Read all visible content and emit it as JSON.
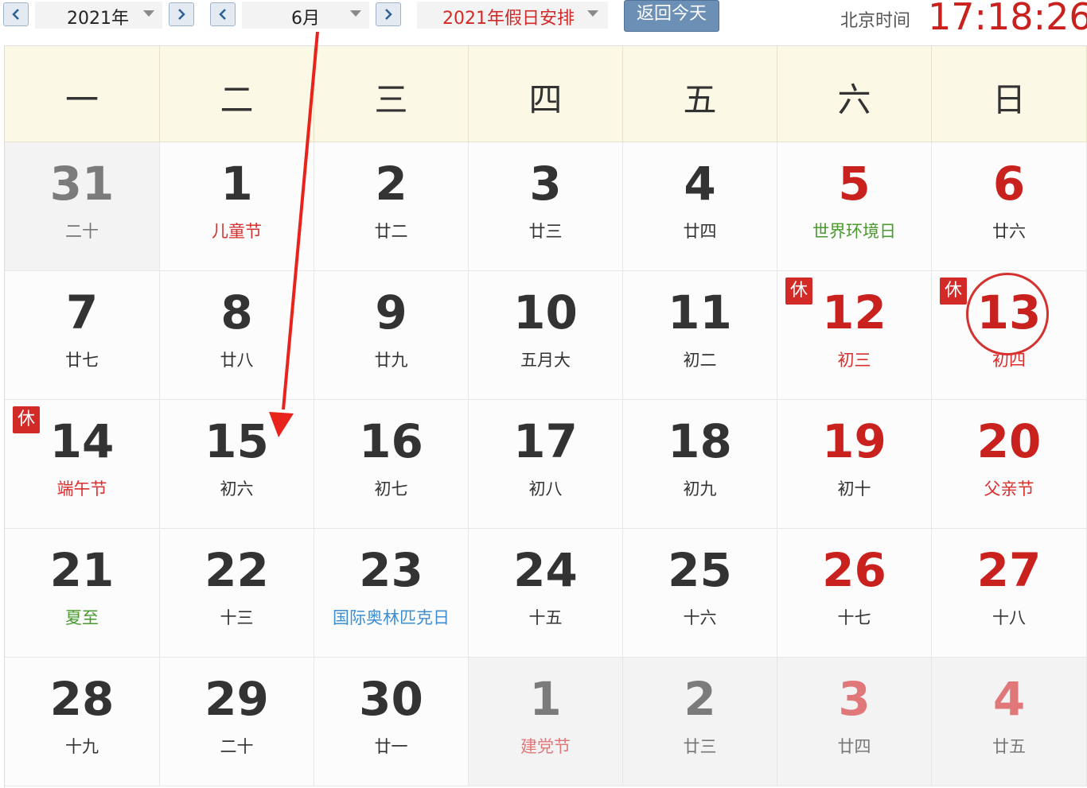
{
  "toolbar": {
    "year_value": "2021年",
    "month_value": "6月",
    "holiday_value": "2021年假日安排",
    "today_button": "返回今天",
    "time_label": "北京时间",
    "time_value": "17:18:26"
  },
  "weekdays": [
    "一",
    "二",
    "三",
    "四",
    "五",
    "六",
    "日"
  ],
  "rest_label": "休",
  "days": [
    {
      "day": "31",
      "lunar": "二十",
      "current": false
    },
    {
      "day": "1",
      "lunar": "儿童节",
      "lunar_color": "red"
    },
    {
      "day": "2",
      "lunar": "廿二"
    },
    {
      "day": "3",
      "lunar": "廿三"
    },
    {
      "day": "4",
      "lunar": "廿四"
    },
    {
      "day": "5",
      "lunar": "世界环境日",
      "lunar_color": "green"
    },
    {
      "day": "6",
      "lunar": "廿六"
    },
    {
      "day": "7",
      "lunar": "廿七"
    },
    {
      "day": "8",
      "lunar": "廿八"
    },
    {
      "day": "9",
      "lunar": "廿九"
    },
    {
      "day": "10",
      "lunar": "五月大"
    },
    {
      "day": "11",
      "lunar": "初二"
    },
    {
      "day": "12",
      "lunar": "初三",
      "lunar_color": "red",
      "rest": true
    },
    {
      "day": "13",
      "lunar": "初四",
      "lunar_color": "red",
      "rest": true,
      "today": true
    },
    {
      "day": "14",
      "lunar": "端午节",
      "lunar_color": "red",
      "rest": true
    },
    {
      "day": "15",
      "lunar": "初六"
    },
    {
      "day": "16",
      "lunar": "初七"
    },
    {
      "day": "17",
      "lunar": "初八"
    },
    {
      "day": "18",
      "lunar": "初九"
    },
    {
      "day": "19",
      "lunar": "初十"
    },
    {
      "day": "20",
      "lunar": "父亲节",
      "lunar_color": "red"
    },
    {
      "day": "21",
      "lunar": "夏至",
      "lunar_color": "green"
    },
    {
      "day": "22",
      "lunar": "十三"
    },
    {
      "day": "23",
      "lunar": "国际奥林匹克日",
      "lunar_color": "blue"
    },
    {
      "day": "24",
      "lunar": "十五"
    },
    {
      "day": "25",
      "lunar": "十六"
    },
    {
      "day": "26",
      "lunar": "十七"
    },
    {
      "day": "27",
      "lunar": "十八"
    },
    {
      "day": "28",
      "lunar": "十九"
    },
    {
      "day": "29",
      "lunar": "二十"
    },
    {
      "day": "30",
      "lunar": "廿一"
    },
    {
      "day": "1",
      "lunar": "建党节",
      "lunar_color": "red",
      "current": false
    },
    {
      "day": "2",
      "lunar": "廿三",
      "current": false
    },
    {
      "day": "3",
      "lunar": "廿四",
      "current": false
    },
    {
      "day": "4",
      "lunar": "廿五",
      "current": false
    }
  ]
}
